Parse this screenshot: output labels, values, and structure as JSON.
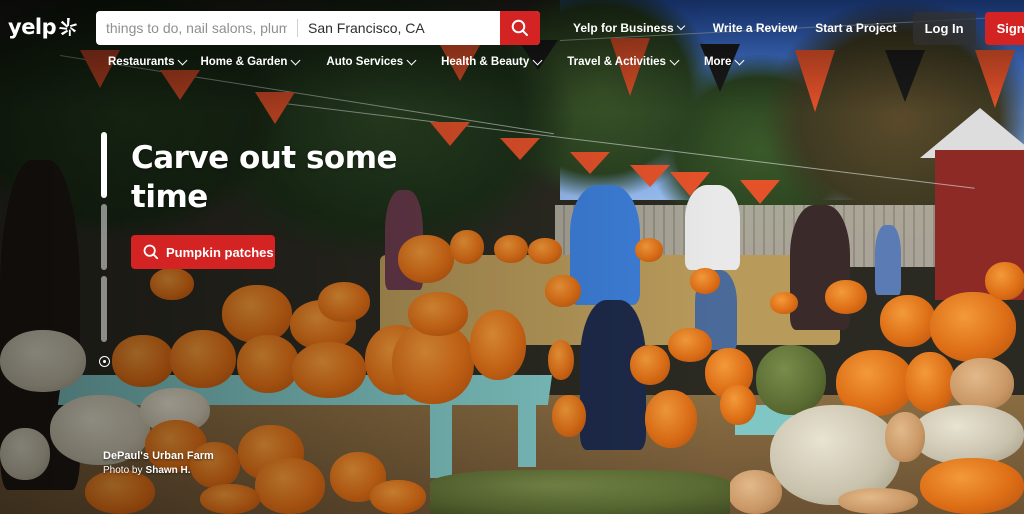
{
  "brand": {
    "logo_text": "yelp",
    "accent": "#d32323"
  },
  "search": {
    "find_placeholder": "things to do, nail salons, plumbers",
    "near_value": "San Francisco, CA",
    "button_icon": "search-icon"
  },
  "topnav": {
    "business": "Yelp for Business",
    "review": "Write a Review",
    "project": "Start a Project",
    "login": "Log In",
    "signup": "Sign Up"
  },
  "categories": [
    {
      "label": "Restaurants"
    },
    {
      "label": "Home & Garden"
    },
    {
      "label": "Auto Services"
    },
    {
      "label": "Health & Beauty"
    },
    {
      "label": "Travel & Activities"
    },
    {
      "label": "More"
    }
  ],
  "hero": {
    "headline": "Carve out some time",
    "cta_label": "Pumpkin patches",
    "cta_icon": "search-icon",
    "credit_business": "DePaul's Urban Farm",
    "credit_prefix": "Photo by",
    "credit_author": "Shawn H.",
    "slide_count": 3,
    "active_slide": 1
  }
}
